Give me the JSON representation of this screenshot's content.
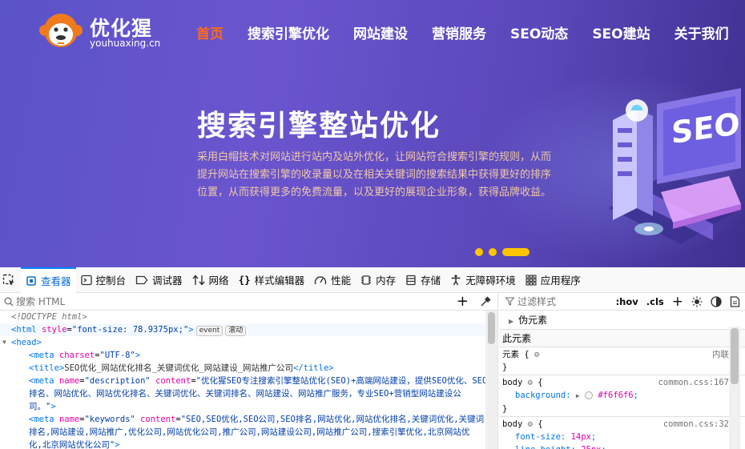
{
  "site": {
    "logo_title": "优化猩",
    "logo_sub": "youhuaxing.cn",
    "nav": [
      "首页",
      "搜索引擎优化",
      "网站建设",
      "营销服务",
      "SEO动态",
      "SEO建站",
      "关于我们"
    ],
    "hero_title": "搜索引擎整站优化",
    "hero_desc": "采用白帽技术对网站进行站内及站外优化，让网站符合搜索引擎的规则，从而提升网站在搜索引擎的收录量以及在相关关键词的搜索结果中获得更好的排序位置，从而获得更多的免费流量，以及更好的展现企业形象，获得品牌收益。",
    "illustration_text": "SEO"
  },
  "devtools": {
    "tabs": [
      "查看器",
      "控制台",
      "调试器",
      "网络",
      "样式编辑器",
      "性能",
      "内存",
      "存储",
      "无障碍环境",
      "应用程序"
    ],
    "search_placeholder": "搜索 HTML",
    "html_lines": {
      "doctype": "<!DOCTYPE html>",
      "html_open": "<html",
      "html_attr": "style",
      "html_val": "\"font-size: 78.9375px;\"",
      "html_close": ">",
      "badge_event": "event",
      "badge_scroll": "滚动",
      "head": "<head>",
      "meta_charset_tag": "<meta",
      "meta_charset_attr": "charset",
      "meta_charset_val": "\"UTF-8\"",
      "meta_end": ">",
      "title_open": "<title>",
      "title_text": "SEO优化_网站优化排名_关键词优化_网站建设_网站推广公司",
      "title_close": "</title>",
      "meta_desc_tag": "<meta",
      "meta_desc_name_attr": "name",
      "meta_desc_name_val": "\"description\"",
      "meta_desc_content_attr": "content",
      "meta_desc_content_l1": "\"优化猩SEO专注搜索引擎整站优化(SEO)+高端网站建设，提供SEO优化、SEO",
      "meta_desc_content_l2": "排名、网站优化、网站优化排名、关键词优化、关键词排名、网站建设、网站推广服务，专业SEO+营销型网站建设公",
      "meta_desc_content_l3": "司。\"",
      "meta_desc_end": ">",
      "meta_kw_tag": "<meta",
      "meta_kw_name_attr": "name",
      "meta_kw_name_val": "\"keywords\"",
      "meta_kw_content_attr": "content",
      "meta_kw_content_l1": "\"SEO,SEO优化,SEO公司,SEO排名,网站优化,网站优化排名,关键词优化,关键词",
      "meta_kw_content_l2": "排名,网站建设,网站推广,优化公司,网站优化公司,推广公司,网站建设公司,网站推广公司,搜索引擎优化,北京网站优",
      "meta_kw_content_l3": "化,北京网站优化公司\"",
      "meta_kw_end": ">"
    },
    "filter_placeholder": "过滤样式",
    "filter_hov": ":hov",
    "filter_cls": ".cls",
    "pseudo_label": "伪元素",
    "this_element": "此元素",
    "element_rule": {
      "selector": "元素 {",
      "source": "内联",
      "close": "}"
    },
    "body_rule_1": {
      "selector": "body",
      "open": "{",
      "source": "common.css:167",
      "prop": "background",
      "value": "#f6f6f6",
      "close": "}"
    },
    "body_rule_2": {
      "selector": "body",
      "open": "{",
      "source": "common.css:32",
      "prop1": "font-size",
      "value1": "14px",
      "prop2": "line-height",
      "value2": "25px"
    }
  }
}
